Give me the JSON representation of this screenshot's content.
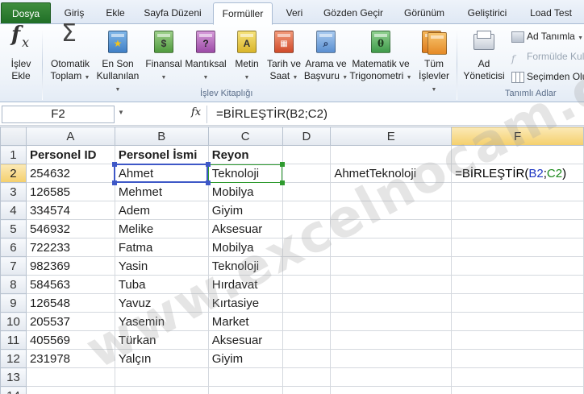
{
  "tabs": [
    {
      "label": "Dosya"
    },
    {
      "label": "Giriş"
    },
    {
      "label": "Ekle"
    },
    {
      "label": "Sayfa Düzeni"
    },
    {
      "label": "Formüller"
    },
    {
      "label": "Veri"
    },
    {
      "label": "Gözden Geçir"
    },
    {
      "label": "Görünüm"
    },
    {
      "label": "Geliştirici"
    },
    {
      "label": "Load Test"
    }
  ],
  "ribbon": {
    "insert_function": {
      "line1": "İşlev",
      "line2": "Ekle"
    },
    "autosum": {
      "line1": "Otomatik",
      "line2": "Toplam"
    },
    "recent": {
      "line1": "En Son",
      "line2": "Kullanılan"
    },
    "financial": {
      "line1": "Finansal"
    },
    "logical": {
      "line1": "Mantıksal"
    },
    "text": {
      "line1": "Metin"
    },
    "datetime": {
      "line1": "Tarih ve",
      "line2": "Saat"
    },
    "lookup": {
      "line1": "Arama ve",
      "line2": "Başvuru"
    },
    "math": {
      "line1": "Matematik ve",
      "line2": "Trigonometri"
    },
    "all": {
      "line1": "Tüm",
      "line2": "İşlevler"
    },
    "name_manager": {
      "line1": "Ad",
      "line2": "Yöneticisi"
    },
    "define_name": "Ad Tanımla",
    "use_in_formula": "Formülde Kul",
    "create_from_selection": "Seçimden Olu",
    "group_function_library": "İşlev Kitaplığı",
    "group_defined_names": "Tanımlı Adlar",
    "colors": {
      "file_tab": "#2a7a2f",
      "selection": "#3e58c7",
      "ref_green": "#1a8a1a"
    }
  },
  "formula_bar": {
    "name_box": "F2",
    "fx": "fx",
    "formula": "=BİRLEŞTİR(B2;C2)"
  },
  "grid": {
    "columns": [
      "A",
      "B",
      "C",
      "D",
      "E",
      "F"
    ],
    "rows": [
      "1",
      "2",
      "3",
      "4",
      "5",
      "6",
      "7",
      "8",
      "9",
      "10",
      "11",
      "12",
      "13",
      "14"
    ],
    "cells": [
      [
        "Personel ID",
        "Personel İsmi",
        "Reyon",
        "",
        "",
        ""
      ],
      [
        "254632",
        "Ahmet",
        "Teknoloji",
        "",
        "AhmetTeknoloji",
        ""
      ],
      [
        "126585",
        "Mehmet",
        "Mobilya",
        "",
        "",
        ""
      ],
      [
        "334574",
        "Adem",
        "Giyim",
        "",
        "",
        ""
      ],
      [
        "546932",
        "Melike",
        "Aksesuar",
        "",
        "",
        ""
      ],
      [
        "722233",
        "Fatma",
        "Mobilya",
        "",
        "",
        ""
      ],
      [
        "982369",
        "Yasin",
        "Teknoloji",
        "",
        "",
        ""
      ],
      [
        "584563",
        "Tuba",
        "Hırdavat",
        "",
        "",
        ""
      ],
      [
        "126548",
        "Yavuz",
        "Kırtasiye",
        "",
        "",
        ""
      ],
      [
        "205537",
        "Yasemin",
        "Market",
        "",
        "",
        ""
      ],
      [
        "405569",
        "Türkan",
        "Aksesuar",
        "",
        "",
        ""
      ],
      [
        "231978",
        "Yalçın",
        "Giyim",
        "",
        "",
        ""
      ],
      [
        "",
        "",
        "",
        "",
        "",
        ""
      ],
      [
        "",
        "",
        "",
        "",
        "",
        ""
      ]
    ],
    "f2_formula": {
      "prefix": "=BİRLEŞTİR(",
      "ref1": "B2",
      "sep": ";",
      "ref2": "C2",
      "suffix": ")"
    }
  },
  "watermark": "www.excelnocam.com"
}
